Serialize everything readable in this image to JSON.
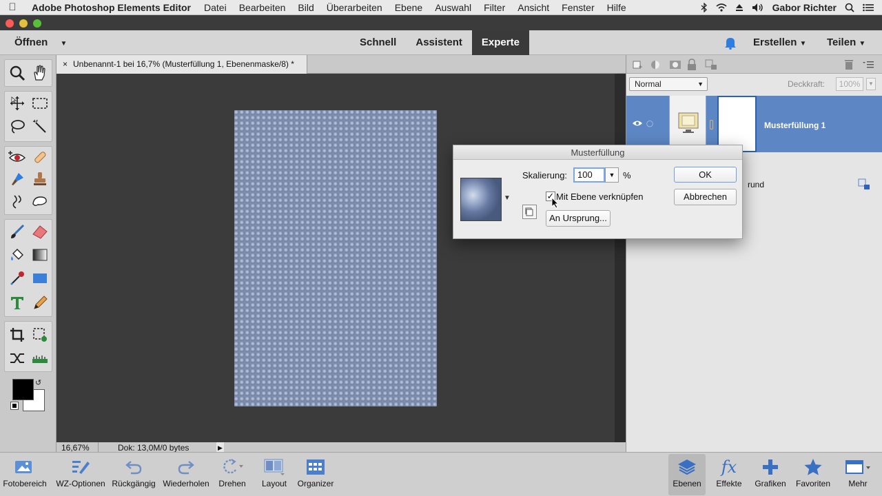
{
  "menubar": {
    "app": "Adobe Photoshop Elements Editor",
    "items": [
      "Datei",
      "Bearbeiten",
      "Bild",
      "Überarbeiten",
      "Ebene",
      "Auswahl",
      "Filter",
      "Ansicht",
      "Fenster",
      "Hilfe"
    ],
    "user": "Gabor Richter"
  },
  "topbar": {
    "open": "Öffnen",
    "modes": [
      "Schnell",
      "Assistent",
      "Experte"
    ],
    "active_mode": "Experte",
    "create": "Erstellen",
    "share": "Teilen"
  },
  "document": {
    "tab_title": "Unbenannt-1 bei 16,7% (Musterfüllung 1, Ebenenmaske/8) *",
    "zoom": "16,67%",
    "doc_info": "Dok: 13,0M/0 bytes"
  },
  "layers": {
    "blend_mode": "Normal",
    "opacity_label": "Deckkraft:",
    "opacity_value": "100%",
    "layer1_name": "Musterfüllung 1",
    "background_partial": "rund"
  },
  "dialog": {
    "title": "Musterfüllung",
    "scale_label": "Skalierung:",
    "scale_value": "100",
    "percent": "%",
    "link_label": "Mit Ebene verknüpfen",
    "link_checked": true,
    "snap_button": "An Ursprung...",
    "ok": "OK",
    "cancel": "Abbrechen"
  },
  "bottombar": {
    "left": [
      "Fotobereich",
      "WZ-Optionen",
      "Rückgängig",
      "Wiederholen",
      "Drehen",
      "Layout",
      "Organizer"
    ],
    "right": [
      "Ebenen",
      "Effekte",
      "Grafiken",
      "Favoriten",
      "Mehr"
    ]
  },
  "colors": {
    "accent": "#5d87c4",
    "pattern": "#7f8ead",
    "foreground": "#000000",
    "background": "#ffffff"
  }
}
